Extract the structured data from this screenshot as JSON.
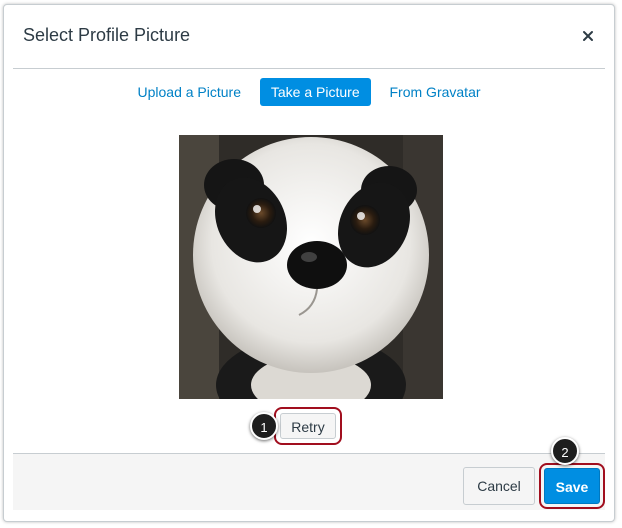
{
  "dialog": {
    "title": "Select Profile Picture",
    "close_icon": "close-icon"
  },
  "tabs": [
    {
      "label": "Upload a Picture",
      "active": false
    },
    {
      "label": "Take a Picture",
      "active": true
    },
    {
      "label": "From Gravatar",
      "active": false
    }
  ],
  "photo": {
    "subject": "panda-plush-photo"
  },
  "retry": {
    "label": "Retry",
    "step": "1"
  },
  "footer": {
    "cancel_label": "Cancel",
    "save_label": "Save",
    "save_step": "2"
  },
  "colors": {
    "accent": "#008ee2",
    "link": "#0081c6",
    "highlight": "#a10e1e"
  }
}
